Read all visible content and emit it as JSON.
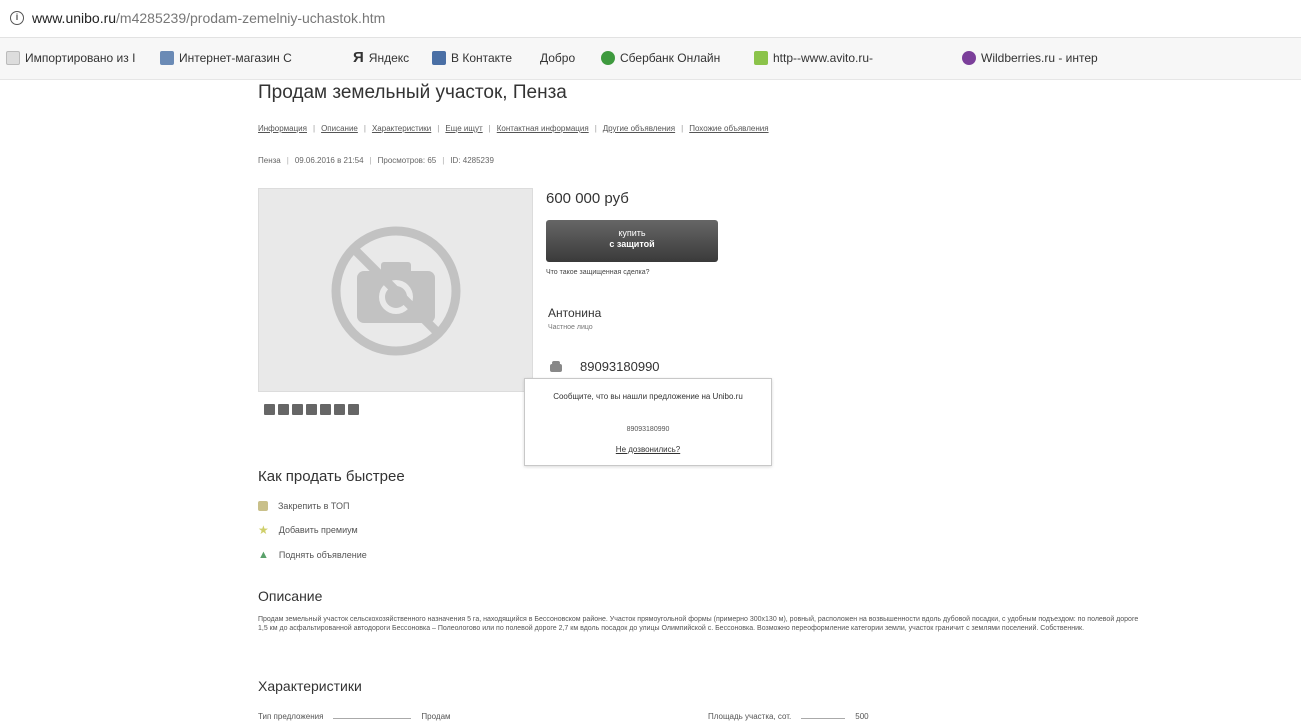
{
  "browser": {
    "url_host": "www.unibo.ru",
    "url_path": "/m4285239/prodam-zemelniy-uchastok.htm",
    "bookmarks": [
      "Импортировано из I",
      "Интернет-магазин С",
      "Яндекс",
      "В Контакте",
      "Добро",
      "Сбербанк Онлайн",
      "http--www.avito.ru-",
      "Wildberries.ru - интер"
    ]
  },
  "listing": {
    "title": "Продам земельный участок, Пенза",
    "tabs": [
      "Информация",
      "Описание",
      "Характеристики",
      "Еще ищут",
      "Контактная информация",
      "Другие объявления",
      "Похожие объявления"
    ],
    "meta": {
      "city": "Пенза",
      "date": "09.06.2016 в 21:54",
      "views": "Просмотров: 65",
      "id": "ID: 4285239"
    },
    "price": "600 000 руб",
    "buy": {
      "line1": "купить",
      "line2": "с защитой"
    },
    "protect_link": "Что такое защищенная сделка?",
    "seller": {
      "name": "Антонина",
      "type": "Частное лицо"
    },
    "phone": "89093180990",
    "popup": {
      "message": "Сообщите, что вы нашли предложение на Unibo.ru",
      "phone": "89093180990",
      "no_call": "Не дозвонились?"
    }
  },
  "promote": {
    "heading": "Как продать быстрее",
    "items": [
      "Закрепить в ТОП",
      "Добавить премиум",
      "Поднять объявление"
    ]
  },
  "description": {
    "heading": "Описание",
    "text": "Продам земельный участок сельскохозяйственного назначения 5 га, находящийся в Бессоновском районе. Участок прямоугольной формы (примерно 300х130 м), ровный, расположен на возвышенности вдоль дубовой посадки, с удобным подъездом: по полевой дороге 1,5 км до асфальтированной автодороги Бессоновка – Полеологово или по полевой дороге 2,7 км вдоль посадок до улицы Олимпийской с. Бессоновка. Возможно переоформление категории земли, участок граничит с землями поселений. Собственник."
  },
  "characteristics": {
    "heading": "Характеристики",
    "rows": [
      {
        "label": "Тип предложения",
        "value": "Продам"
      },
      {
        "label": "Площадь участка, сот.",
        "value": "500"
      }
    ]
  }
}
